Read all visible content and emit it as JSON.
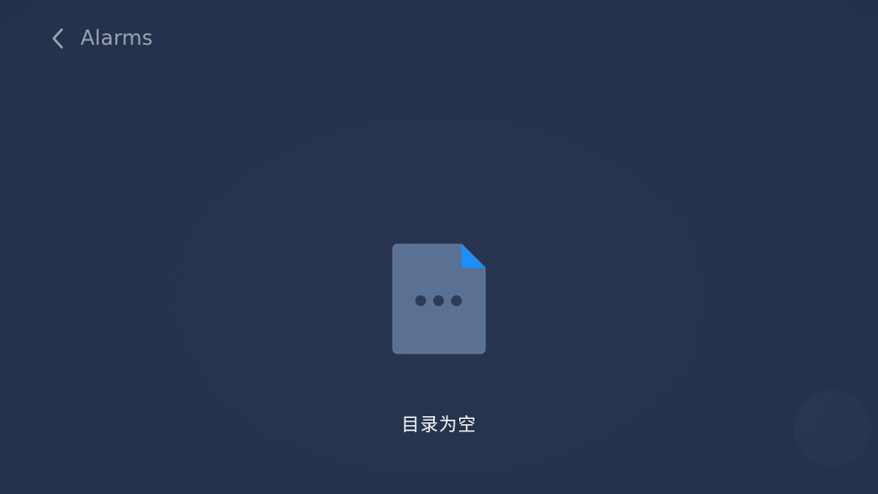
{
  "header": {
    "title": "Alarms",
    "back_icon": "chevron-left-icon"
  },
  "empty_state": {
    "icon": "document-more-icon",
    "message": "目录为空"
  },
  "colors": {
    "background": "#283550",
    "title_text": "#9aa3b2",
    "doc_body": "#5a7194",
    "doc_corner": "#1890ff",
    "message_text": "#ffffff"
  }
}
